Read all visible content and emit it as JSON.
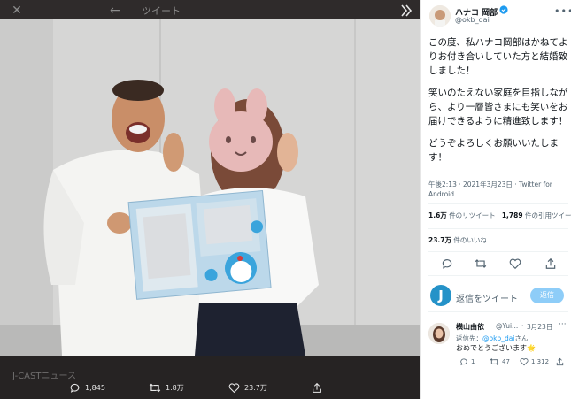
{
  "viewer": {
    "title": "ツイート",
    "close_icon": "close-icon",
    "back_icon": "back-arrow-icon",
    "collapse_icon": "double-chevron-right-icon",
    "footer_source": "J-CASTニュース",
    "actions": {
      "replies": "1,845",
      "retweets": "1.8万",
      "likes": "23.7万"
    }
  },
  "panel": {
    "author": {
      "name": "ハナコ 岡部",
      "handle": "@okb_dai",
      "verified": true
    },
    "tweet": {
      "paragraphs": [
        "この度、私ハナコ岡部はかねてよりお付き合いしていた方と結婚致しました！",
        "笑いのたえない家庭を目指しながら、より一層皆さまにも笑いをお届けできるように精進致します！",
        "どうぞよろしくお願いいたします！"
      ],
      "meta": "午後2:13 · 2021年3月23日 · Twitter for Android"
    },
    "stats": {
      "retweets_count": "1.6万",
      "retweets_label": "件のリツイート",
      "quotes_count": "1,789",
      "quotes_label": "件の引用ツイート",
      "likes_count": "23.7万",
      "likes_label": "件のいいね"
    },
    "reply_box": {
      "avatar_letter": "J",
      "placeholder": "返信をツイート",
      "button_label": "返信"
    },
    "reply": {
      "name": "横山由依",
      "handle": "@Yui...",
      "date": "3月23日",
      "reply_prefix": "返信先：",
      "reply_mention": "@okb_dai",
      "reply_suffix": "さん",
      "text": "おめでとうございます🌟",
      "replies": "1",
      "retweets": "47",
      "likes": "1,312"
    }
  },
  "colors": {
    "accent": "#1d9bf0",
    "verified": "#1d9bf0",
    "reply_button": "#8ecdf8",
    "viewer_bg": "#2f2b2b"
  }
}
